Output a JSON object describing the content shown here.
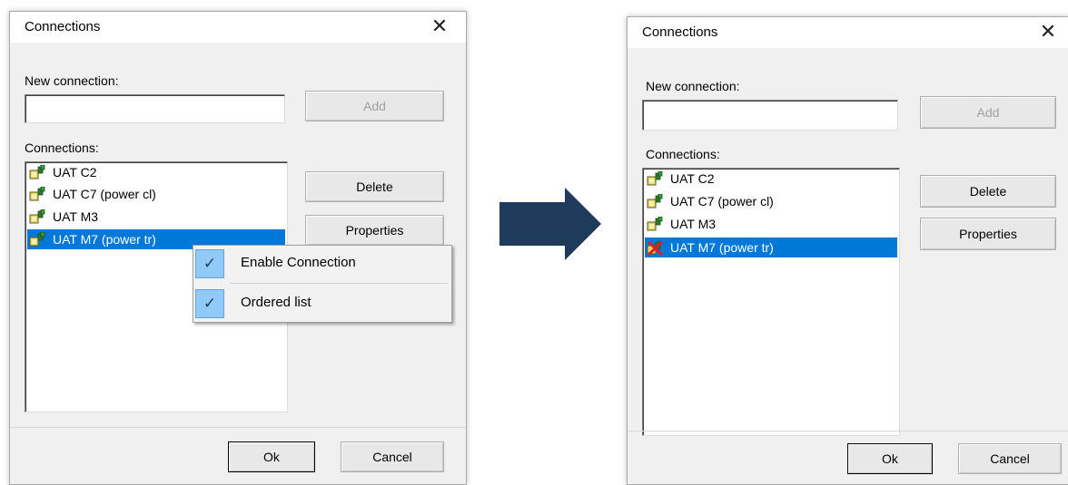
{
  "before": {
    "title": "Connections",
    "new_connection_label": "New connection:",
    "new_connection_value": "",
    "add_label": "Add",
    "connections_label": "Connections:",
    "items": [
      {
        "label": "UAT C2",
        "enabled": true,
        "selected": false
      },
      {
        "label": "UAT C7 (power cl)",
        "enabled": true,
        "selected": false
      },
      {
        "label": "UAT M3",
        "enabled": true,
        "selected": false
      },
      {
        "label": "UAT M7 (power tr)",
        "enabled": true,
        "selected": true
      }
    ],
    "delete_label": "Delete",
    "properties_label": "Properties",
    "ok_label": "Ok",
    "cancel_label": "Cancel",
    "context_menu": [
      {
        "label": "Enable Connection",
        "checked": true
      },
      {
        "label": "Ordered list",
        "checked": true
      }
    ]
  },
  "after": {
    "title": "Connections",
    "new_connection_label": "New connection:",
    "new_connection_value": "",
    "add_label": "Add",
    "connections_label": "Connections:",
    "items": [
      {
        "label": "UAT C2",
        "enabled": true,
        "selected": false
      },
      {
        "label": "UAT C7 (power cl)",
        "enabled": true,
        "selected": false
      },
      {
        "label": "UAT M3",
        "enabled": true,
        "selected": false
      },
      {
        "label": "UAT M7 (power tr)",
        "enabled": false,
        "selected": true
      }
    ],
    "delete_label": "Delete",
    "properties_label": "Properties",
    "ok_label": "Ok",
    "cancel_label": "Cancel"
  },
  "icons": {
    "connection": "connection-icon",
    "disabled_connection": "disabled-connection-icon",
    "close": "close-icon",
    "check": "check-icon",
    "arrow": "right-arrow-icon"
  },
  "colors": {
    "selection": "#0078d7",
    "arrow": "#1f3b5c",
    "menu_check": "#91c9f7"
  }
}
